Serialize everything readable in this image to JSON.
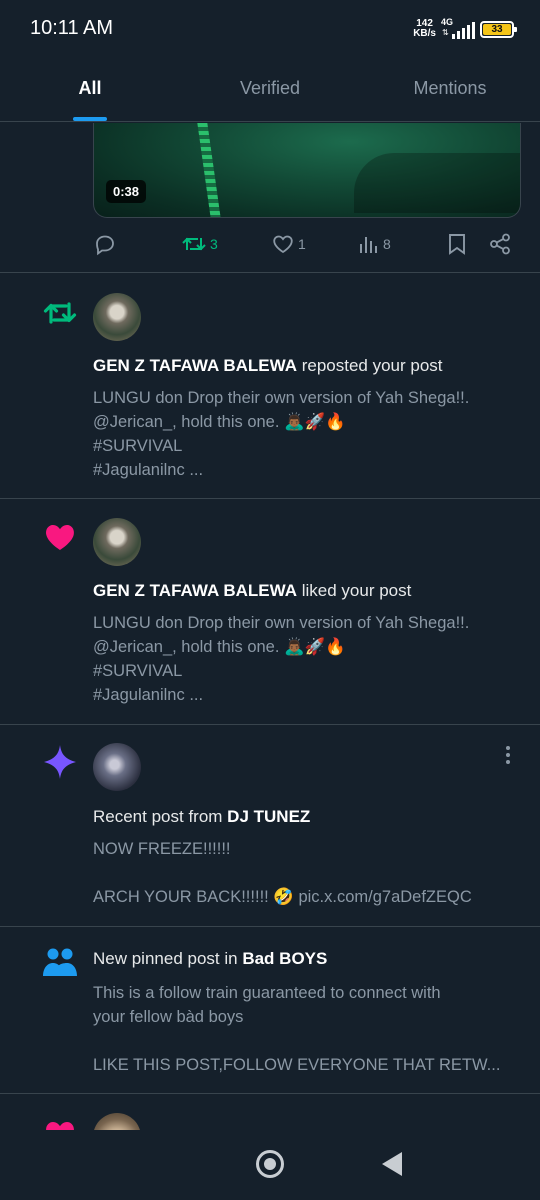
{
  "status_bar": {
    "time": "10:11 AM",
    "net_speed_value": "142",
    "net_speed_unit": "KB/s",
    "network_type": "4G",
    "battery_level": "33"
  },
  "tabs": [
    {
      "label": "All",
      "active": true
    },
    {
      "label": "Verified",
      "active": false
    },
    {
      "label": "Mentions",
      "active": false
    }
  ],
  "top_post": {
    "video_duration": "0:38",
    "reposts": "3",
    "likes": "1",
    "views": "8"
  },
  "notifications": [
    {
      "type": "repost",
      "icon": "repost-icon",
      "user": "GEN Z TAFAWA BALEWA",
      "action": " reposted your post",
      "lines": [
        "LUNGU don Drop their own version of Yah Shega!!.",
        "@Jerican_,  hold this one. 🙇🏾‍♂️🚀🔥",
        "#SURVIVAL",
        "#Jagulanilnc ..."
      ]
    },
    {
      "type": "like",
      "icon": "heart-icon",
      "user": "GEN Z TAFAWA BALEWA",
      "action": " liked your post",
      "lines": [
        "LUNGU don Drop their own version of Yah Shega!!.",
        "@Jerican_,  hold this one. 🙇🏾‍♂️🚀🔥",
        "#SURVIVAL",
        "#Jagulanilnc ..."
      ]
    },
    {
      "type": "recent",
      "icon": "sparkle-icon",
      "prefix": "Recent post from ",
      "user": "DJ TUNEZ",
      "lines": [
        "NOW FREEZE!!!!!!",
        "",
        "ARCH YOUR BACK!!!!!! 🤣 pic.x.com/g7aDefZEQC"
      ]
    },
    {
      "type": "pinned",
      "icon": "community-icon",
      "prefix": "New pinned post in ",
      "user": "Bad BOYS",
      "lines": [
        "This is a follow train guaranteed to connect with",
        "your fellow bàd boys",
        "",
        "LIKE THIS POST,FOLLOW EVERYONE  THAT RETW..."
      ]
    }
  ],
  "colors": {
    "background": "#15202b",
    "accent": "#1d9bf0",
    "repost": "#00ba7c",
    "like": "#f91880",
    "sparkle": "#7856ff"
  }
}
